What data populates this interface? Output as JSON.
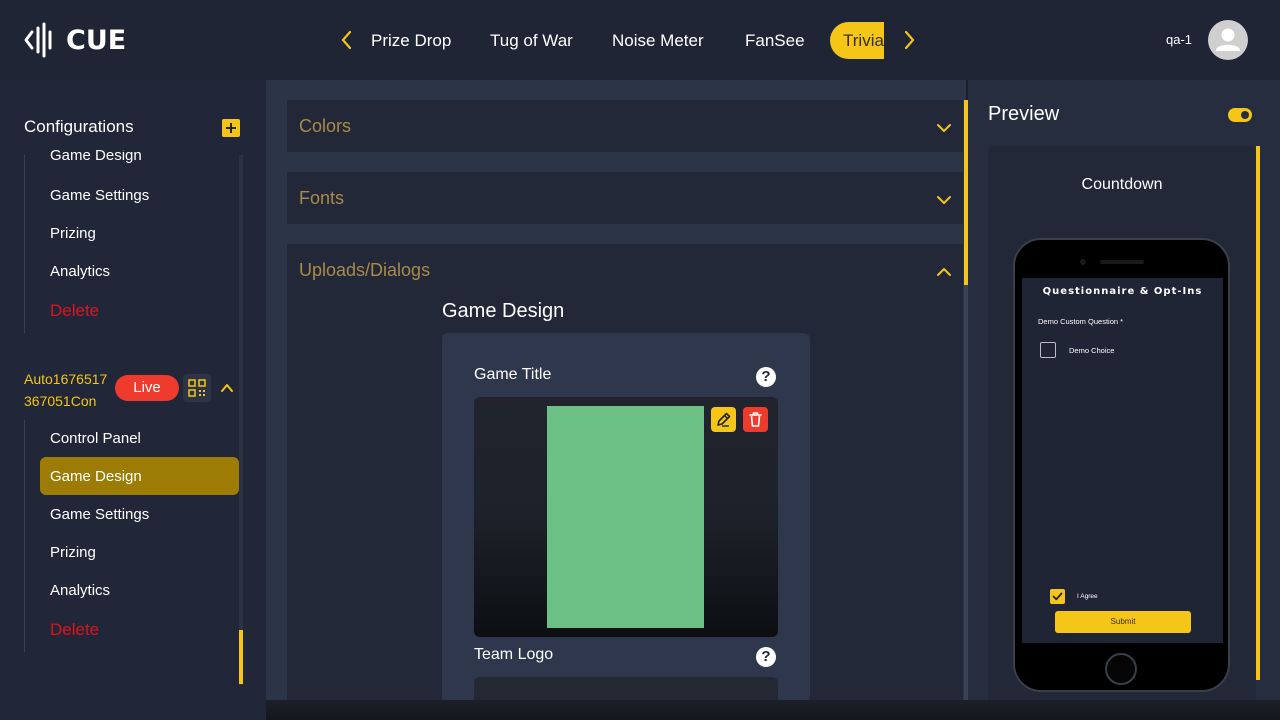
{
  "header": {
    "logo_text": "CUE",
    "tabs": [
      "Prize Drop",
      "Tug of War",
      "Noise Meter",
      "FanSee",
      "Trivia"
    ],
    "active_tab": "Trivia",
    "user_name": "qa-1"
  },
  "sidebar": {
    "title": "Configurations",
    "group1": {
      "items": [
        "Game Design",
        "Game Settings",
        "Prizing",
        "Analytics"
      ],
      "delete_label": "Delete"
    },
    "config_name": "Auto1676517367051Con",
    "live_label": "Live",
    "group2": {
      "items": [
        "Control Panel",
        "Game Design",
        "Game Settings",
        "Prizing",
        "Analytics"
      ],
      "active_item": "Game Design",
      "delete_label": "Delete"
    }
  },
  "main": {
    "accordions": [
      {
        "title": "Colors",
        "expanded": false
      },
      {
        "title": "Fonts",
        "expanded": false
      },
      {
        "title": "Uploads/Dialogs",
        "expanded": true
      }
    ],
    "section_title": "Game Design",
    "fields": [
      {
        "label": "Game Title",
        "help": "?"
      },
      {
        "label": "Team Logo",
        "help": "?"
      }
    ]
  },
  "preview": {
    "title": "Preview",
    "toggle_on": true,
    "screen_title": "Countdown",
    "phone": {
      "heading": "Questionnaire & Opt-Ins",
      "question": "Demo Custom Question *",
      "choice": "Demo Choice",
      "agree": "I Agree",
      "submit": "Submit"
    }
  },
  "colors": {
    "accent": "#f5c518",
    "danger": "#ef3b2d",
    "delete_text": "#e0121b",
    "image_fill": "#6ac085"
  }
}
